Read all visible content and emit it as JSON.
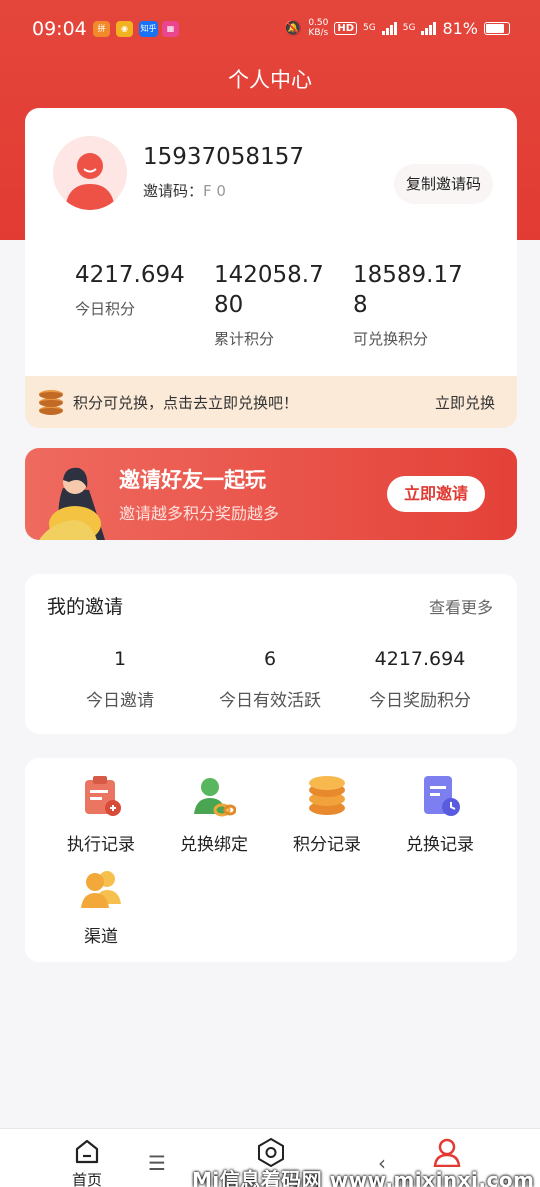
{
  "status_bar": {
    "time": "09:04",
    "speed": "0.50",
    "speed_unit": "KB/s",
    "hd": "HD",
    "net1": "5G",
    "net2": "5G",
    "battery": "81%",
    "notif_zhihu": "知乎"
  },
  "page_title": "个人中心",
  "profile": {
    "phone": "15937058157",
    "invite_code_label": "邀请码：",
    "invite_code": "F       0",
    "copy_button": "复制邀请码"
  },
  "stats": [
    {
      "value": "4217.694",
      "label": "今日积分"
    },
    {
      "value": "142058.780",
      "label": "累计积分"
    },
    {
      "value": "18589.178",
      "label": "可兑换积分"
    }
  ],
  "exchange_bar": {
    "text": "积分可兑换，点击去立即兑换吧！",
    "button": "立即兑换"
  },
  "invite_banner": {
    "title": "邀请好友一起玩",
    "subtitle": "邀请越多积分奖励越多",
    "button": "立即邀请"
  },
  "my_invite": {
    "title": "我的邀请",
    "more": "查看更多",
    "stats": [
      {
        "value": "1",
        "label": "今日邀请"
      },
      {
        "value": "6",
        "label": "今日有效活跃"
      },
      {
        "value": "4217.694",
        "label": "今日奖励积分"
      }
    ]
  },
  "menu": [
    {
      "label": "执行记录",
      "icon": "clipboard-icon"
    },
    {
      "label": "兑换绑定",
      "icon": "user-link-icon"
    },
    {
      "label": "积分记录",
      "icon": "coins-icon"
    },
    {
      "label": "兑换记录",
      "icon": "document-clock-icon"
    },
    {
      "label": "渠道",
      "icon": "users-icon"
    }
  ],
  "bottom_nav": {
    "home": "首页",
    "profile": "个人中心"
  },
  "watermark": "Mi信息着码网 www.mixinxi.com",
  "colors": {
    "primary": "#e23b33",
    "exchange_bg": "#fbead8"
  }
}
